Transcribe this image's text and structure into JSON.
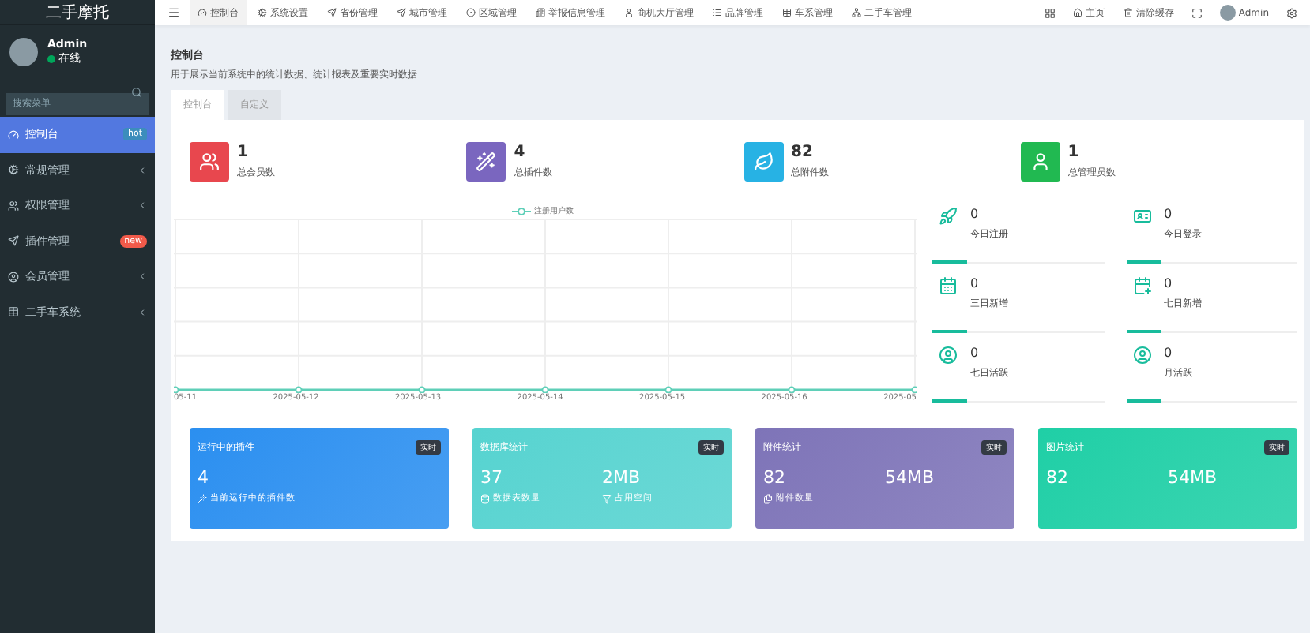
{
  "sidebar": {
    "brand": "二手摩托",
    "user": {
      "name": "Admin",
      "status": "在线",
      "online": true
    },
    "search": {
      "placeholder": "搜索菜单"
    },
    "items": [
      {
        "label": "控制台",
        "selected": true,
        "expandable": false,
        "badge": {
          "text": "hot",
          "color": "#3c8dbc"
        }
      },
      {
        "label": "常规管理",
        "selected": false,
        "expandable": true
      },
      {
        "label": "权限管理",
        "selected": false,
        "expandable": true
      },
      {
        "label": "插件管理",
        "selected": false,
        "expandable": false,
        "badge": {
          "text": "new",
          "color": "#f15a4a"
        }
      },
      {
        "label": "会员管理",
        "selected": false,
        "expandable": true
      },
      {
        "label": "二手车系统",
        "selected": false,
        "expandable": true
      }
    ]
  },
  "topnav": {
    "items": [
      {
        "label": "控制台",
        "selected": true
      },
      {
        "label": "系统设置",
        "selected": false
      },
      {
        "label": "省份管理",
        "selected": false
      },
      {
        "label": "城市管理",
        "selected": false
      },
      {
        "label": "区域管理",
        "selected": false
      },
      {
        "label": "举报信息管理",
        "selected": false
      },
      {
        "label": "商机大厅管理",
        "selected": false
      },
      {
        "label": "品牌管理",
        "selected": false
      },
      {
        "label": "车系管理",
        "selected": false
      },
      {
        "label": "二手车管理",
        "selected": false
      }
    ],
    "links": [
      "主页",
      "清除缓存"
    ],
    "user": "Admin"
  },
  "page": {
    "title": "控制台",
    "description": "用于展示当前系统中的统计数据、统计报表及重要实时数据"
  },
  "tabs": [
    {
      "label": "控制台",
      "selected": true
    },
    {
      "label": "自定义",
      "selected": false
    }
  ],
  "stats": [
    {
      "value": "1",
      "label": "总会员数",
      "color": "#e8474e"
    },
    {
      "value": "4",
      "label": "总插件数",
      "color": "#7a66bf"
    },
    {
      "value": "82",
      "label": "总附件数",
      "color": "#27b2e4"
    },
    {
      "value": "1",
      "label": "总管理员数",
      "color": "#21b951"
    }
  ],
  "chart": {
    "legend": "注册用户数",
    "x_labels": [
      "05-11",
      "2025-05-12",
      "2025-05-13",
      "2025-05-14",
      "2025-05-15",
      "2025-05-16",
      "2025-05"
    ]
  },
  "user_stats": [
    {
      "value": "0",
      "label": "今日注册"
    },
    {
      "value": "0",
      "label": "今日登录"
    },
    {
      "value": "0",
      "label": "三日新增"
    },
    {
      "value": "0",
      "label": "七日新增"
    },
    {
      "value": "0",
      "label": "七日活跃"
    },
    {
      "value": "0",
      "label": "月活跃"
    }
  ],
  "cards": [
    {
      "title": "运行中的插件",
      "badge": "实时",
      "color": "#2b8ff0",
      "metrics": [
        {
          "value": "4",
          "label": "当前运行中的插件数"
        }
      ]
    },
    {
      "title": "数据库统计",
      "badge": "实时",
      "color": "#56d3d0",
      "metrics": [
        {
          "value": "37",
          "label": "数据表数量"
        },
        {
          "value": "2MB",
          "label": "占用空间"
        }
      ]
    },
    {
      "title": "附件统计",
      "badge": "实时",
      "color": "#7e74b8",
      "metrics": [
        {
          "value": "82",
          "label": "附件数量"
        },
        {
          "value": "54MB"
        }
      ]
    },
    {
      "title": "图片统计",
      "badge": "实时",
      "color": "#1fcfa6",
      "metrics": [
        {
          "value": "82"
        },
        {
          "value": "54MB"
        }
      ]
    }
  ]
}
